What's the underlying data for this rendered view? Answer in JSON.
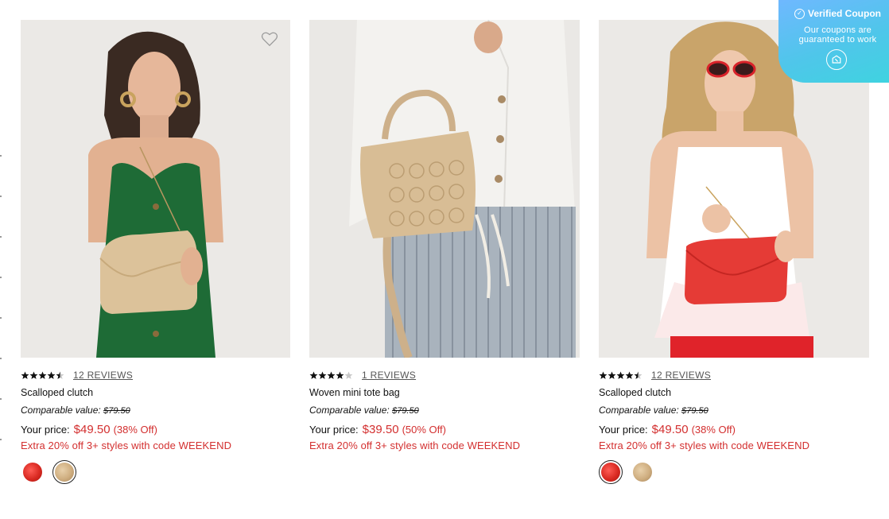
{
  "coupon": {
    "title": "Verified Coupon",
    "subtitle_line1": "Our coupons are",
    "subtitle_line2": "guaranteed to work"
  },
  "products": [
    {
      "rating": 4.5,
      "reviews": "12 REVIEWS",
      "name": "Scalloped clutch",
      "comparable_label": "Comparable value:",
      "comparable_price": "$79.50",
      "price_label": "Your price:",
      "price": "$49.50",
      "discount": "(38% Off)",
      "promo": "Extra 20% off 3+ styles with code WEEKEND",
      "swatches": [
        "red",
        "natural"
      ],
      "selected_swatch": "natural"
    },
    {
      "rating": 4,
      "reviews": "1 REVIEWS",
      "name": "Woven mini tote bag",
      "comparable_label": "Comparable value:",
      "comparable_price": "$79.50",
      "price_label": "Your price:",
      "price": "$39.50",
      "discount": "(50% Off)",
      "promo": "Extra 20% off 3+ styles with code WEEKEND",
      "swatches": [],
      "selected_swatch": ""
    },
    {
      "rating": 4.5,
      "reviews": "12 REVIEWS",
      "name": "Scalloped clutch",
      "comparable_label": "Comparable value:",
      "comparable_price": "$79.50",
      "price_label": "Your price:",
      "price": "$49.50",
      "discount": "(38% Off)",
      "promo": "Extra 20% off 3+ styles with code WEEKEND",
      "swatches": [
        "red",
        "natural"
      ],
      "selected_swatch": "red"
    }
  ],
  "colors": {
    "sale_red": "#d32f2f",
    "coupon_blue": "#4fc6ea"
  },
  "icons": {
    "wishlist": "heart-outline-icon",
    "coupon_check": "check-circle-icon",
    "coupon_logo": "coupon-brand-icon"
  }
}
